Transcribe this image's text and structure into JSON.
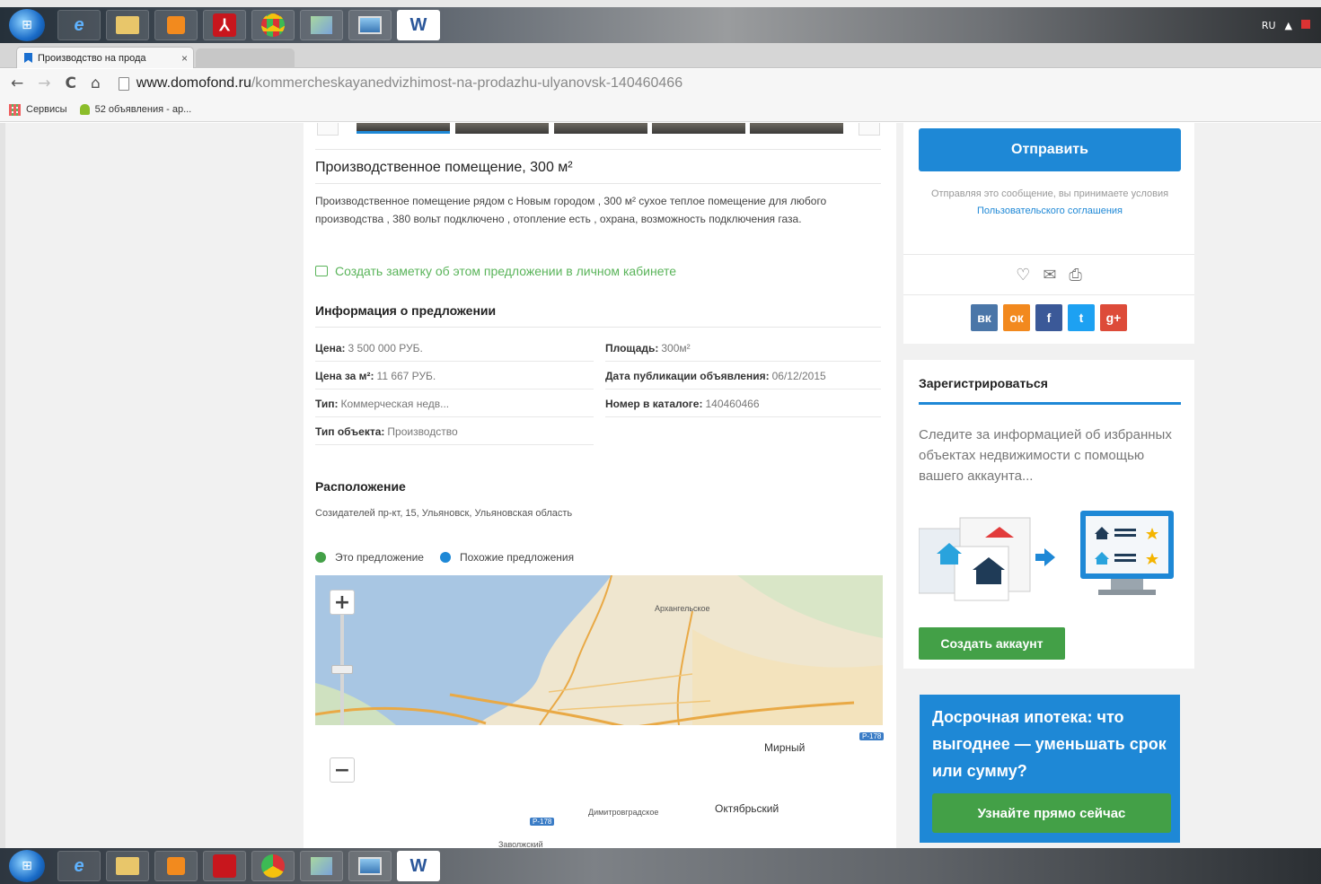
{
  "browser": {
    "tab_title": "Производство на прода",
    "tab_close": "×",
    "url_host": "www.domofond.ru",
    "url_path": "/kommercheskayanedvizhimost-na-prodazhu-ulyanovsk-140460466",
    "nav_back": "←",
    "nav_forward": "→",
    "nav_reload": "C",
    "nav_home": "⌂",
    "bookmarks": [
      "Сервисы",
      "52 объявления - ар..."
    ]
  },
  "taskbar": {
    "apps": [
      "e",
      "",
      "",
      "",
      "",
      "",
      "",
      "W"
    ],
    "lang": "RU",
    "flag_indicator": "▲"
  },
  "listing": {
    "title": "Производственное помещение, 300 м²",
    "description": "Производственное помещение рядом с Новым городом , 300 м² сухое теплое помещение для любого производства , 380 вольт подключено , отопление есть , охрана, возможность подключения газа.",
    "note_link": "Создать заметку об этом предложении в личном кабинете"
  },
  "info": {
    "heading": "Информация о предложении",
    "price_label": "Цена:",
    "price_value": "3 500 000 РУБ.",
    "area_label": "Площадь:",
    "area_value": "300м²",
    "price_m2_label": "Цена за м²:",
    "price_m2_value": "11 667 РУБ.",
    "date_label": "Дата публикации объявления:",
    "date_value": "06/12/2015",
    "type_label": "Тип:",
    "type_value": "Коммерческая недв...",
    "catalog_label": "Номер в каталоге:",
    "catalog_value": "140460466",
    "object_label": "Тип объекта:",
    "object_value": "Производство"
  },
  "location": {
    "heading": "Расположение",
    "address": "Созидателей пр-кт, 15, Ульяновск, Ульяновская область",
    "legend_this": "Это предложение",
    "legend_similar": "Похожие предложения",
    "legend_this_color": "#43a047",
    "legend_similar_color": "#1e88d6",
    "zoom_in": "+",
    "zoom_out": "−",
    "labels": {
      "arkhangelskoe": "Архангельское",
      "mirny": "Мирный",
      "oktyabrsky": "Октябрьский",
      "dimitrovgrad": "Димитровградское",
      "zavolzhsky": "Заволжский",
      "p178": "Р-178",
      "p178b": "Р-178"
    }
  },
  "sidebar": {
    "send_button": "Отправить",
    "terms_text": "Отправляя это сообщение, вы принимаете условия",
    "terms_link": "Пользовательского соглашения",
    "social": [
      "вк",
      "ок",
      "f",
      "t",
      "g+"
    ],
    "register_title": "Зарегистрироваться",
    "register_text": "Следите за информацией об избранных объектах недвижимости с помощью вашего аккаунта...",
    "create_account": "Создать аккаунт",
    "promo_title": "Досрочная ипотека: что выгоднее — уменьшать срок или сумму?",
    "promo_button": "Узнайте прямо сейчас"
  }
}
